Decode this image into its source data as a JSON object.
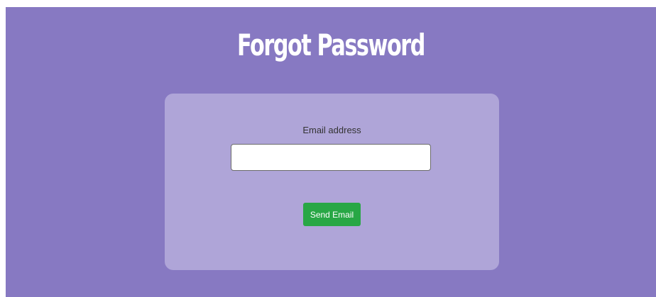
{
  "page": {
    "title": "Forgot Password",
    "background_color": "#8779c2"
  },
  "form": {
    "card_color": "#afa5d8",
    "email_label": "Email address",
    "email_value": "",
    "email_placeholder": "",
    "submit_label": "Send Email",
    "submit_color": "#28a745"
  }
}
